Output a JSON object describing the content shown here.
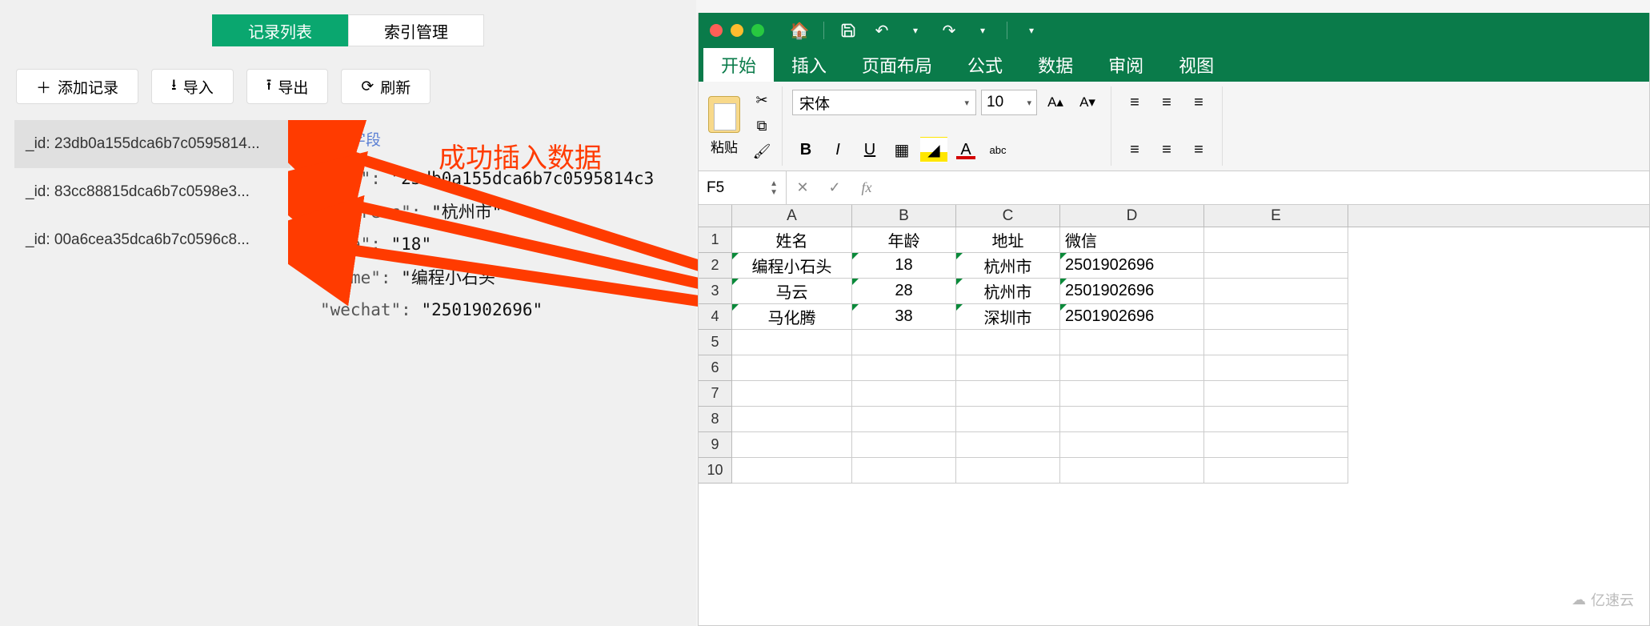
{
  "db": {
    "tabs": {
      "records": "记录列表",
      "indexes": "索引管理"
    },
    "toolbar": {
      "add": "添加记录",
      "import": "导入",
      "export": "导出",
      "refresh": "刷新"
    },
    "records": [
      "_id: 23db0a155dca6b7c0595814...",
      "_id: 83cc88815dca6b7c0598e3...",
      "_id: 00a6cea35dca6b7c0596c8..."
    ],
    "detail": {
      "add_field": "添加字段",
      "fields": [
        {
          "key": "\"_id\":",
          "val": "\"23db0a155dca6b7c0595814c3"
        },
        {
          "key": "\"address\":",
          "val": "\"杭州市\""
        },
        {
          "key": "\"age\":",
          "val": "\"18\""
        },
        {
          "key": "\"name\":",
          "val": "\"编程小石头\""
        },
        {
          "key": "\"wechat\":",
          "val": "\"2501902696\""
        }
      ]
    },
    "annotation": "成功插入数据"
  },
  "excel": {
    "ribbon_tabs": [
      "开始",
      "插入",
      "页面布局",
      "公式",
      "数据",
      "审阅",
      "视图"
    ],
    "paste_label": "粘贴",
    "font_name": "宋体",
    "font_size": "10",
    "name_box": "F5",
    "columns": [
      "A",
      "B",
      "C",
      "D",
      "E"
    ],
    "rows": [
      {
        "n": "1",
        "cells": [
          "姓名",
          "年龄",
          "地址",
          "微信",
          ""
        ]
      },
      {
        "n": "2",
        "cells": [
          "编程小石头",
          "18",
          "杭州市",
          "2501902696",
          ""
        ]
      },
      {
        "n": "3",
        "cells": [
          "马云",
          "28",
          "杭州市",
          "2501902696",
          ""
        ]
      },
      {
        "n": "4",
        "cells": [
          "马化腾",
          "38",
          "深圳市",
          "2501902696",
          ""
        ]
      },
      {
        "n": "5",
        "cells": [
          "",
          "",
          "",
          "",
          ""
        ]
      },
      {
        "n": "6",
        "cells": [
          "",
          "",
          "",
          "",
          ""
        ]
      },
      {
        "n": "7",
        "cells": [
          "",
          "",
          "",
          "",
          ""
        ]
      },
      {
        "n": "8",
        "cells": [
          "",
          "",
          "",
          "",
          ""
        ]
      },
      {
        "n": "9",
        "cells": [
          "",
          "",
          "",
          "",
          ""
        ]
      },
      {
        "n": "10",
        "cells": [
          "",
          "",
          "",
          "",
          ""
        ]
      }
    ]
  },
  "watermark": "亿速云"
}
